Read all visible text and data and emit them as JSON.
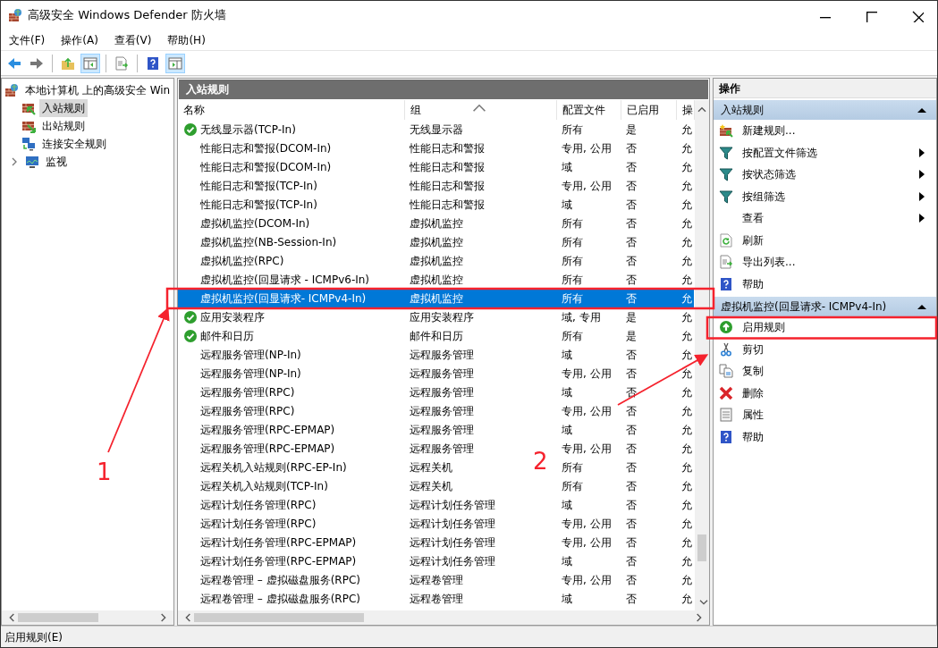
{
  "window": {
    "title": "高级安全 Windows Defender 防火墙"
  },
  "menu": [
    "文件(F)",
    "操作(A)",
    "查看(V)",
    "帮助(H)"
  ],
  "toolbar": [
    {
      "pressed": false
    },
    {
      "pressed": false
    },
    {
      "pressed": false
    },
    {
      "pressed": true
    },
    {
      "pressed": false
    },
    {
      "pressed": false
    },
    {
      "pressed": true
    }
  ],
  "tree": {
    "label": "本地计算机 上的高级安全 Win",
    "children": [
      {
        "label": "入站规则",
        "selected": true
      },
      {
        "label": "出站规则",
        "selected": false
      },
      {
        "label": "连接安全规则",
        "selected": false
      },
      {
        "label": "监视",
        "selected": false,
        "expanded": false
      }
    ]
  },
  "center": {
    "title": "入站规则",
    "columns": [
      "名称",
      "组",
      "配置文件",
      "已启用",
      "操"
    ],
    "rows": [
      {
        "name": "无线显示器(TCP-In)",
        "group": "无线显示器",
        "profile": "所有",
        "enabled": "是",
        "action": "允",
        "active": true,
        "selected": false
      },
      {
        "name": "性能日志和警报(DCOM-In)",
        "group": "性能日志和警报",
        "profile": "专用, 公用",
        "enabled": "否",
        "action": "允",
        "active": false,
        "selected": false
      },
      {
        "name": "性能日志和警报(DCOM-In)",
        "group": "性能日志和警报",
        "profile": "域",
        "enabled": "否",
        "action": "允",
        "active": false,
        "selected": false
      },
      {
        "name": "性能日志和警报(TCP-In)",
        "group": "性能日志和警报",
        "profile": "专用, 公用",
        "enabled": "否",
        "action": "允",
        "active": false,
        "selected": false
      },
      {
        "name": "性能日志和警报(TCP-In)",
        "group": "性能日志和警报",
        "profile": "域",
        "enabled": "否",
        "action": "允",
        "active": false,
        "selected": false
      },
      {
        "name": "虚拟机监控(DCOM-In)",
        "group": "虚拟机监控",
        "profile": "所有",
        "enabled": "否",
        "action": "允",
        "active": false,
        "selected": false
      },
      {
        "name": "虚拟机监控(NB-Session-In)",
        "group": "虚拟机监控",
        "profile": "所有",
        "enabled": "否",
        "action": "允",
        "active": false,
        "selected": false
      },
      {
        "name": "虚拟机监控(RPC)",
        "group": "虚拟机监控",
        "profile": "所有",
        "enabled": "否",
        "action": "允",
        "active": false,
        "selected": false
      },
      {
        "name": "虚拟机监控(回显请求 - ICMPv6-In)",
        "group": "虚拟机监控",
        "profile": "所有",
        "enabled": "否",
        "action": "允",
        "active": false,
        "selected": false
      },
      {
        "name": "虚拟机监控(回显请求- ICMPv4-In)",
        "group": "虚拟机监控",
        "profile": "所有",
        "enabled": "否",
        "action": "允",
        "active": false,
        "selected": true
      },
      {
        "name": "应用安装程序",
        "group": "应用安装程序",
        "profile": "域, 专用",
        "enabled": "是",
        "action": "允",
        "active": true,
        "selected": false
      },
      {
        "name": "邮件和日历",
        "group": "邮件和日历",
        "profile": "所有",
        "enabled": "是",
        "action": "允",
        "active": true,
        "selected": false
      },
      {
        "name": "远程服务管理(NP-In)",
        "group": "远程服务管理",
        "profile": "域",
        "enabled": "否",
        "action": "允",
        "active": false,
        "selected": false
      },
      {
        "name": "远程服务管理(NP-In)",
        "group": "远程服务管理",
        "profile": "专用, 公用",
        "enabled": "否",
        "action": "允",
        "active": false,
        "selected": false
      },
      {
        "name": "远程服务管理(RPC)",
        "group": "远程服务管理",
        "profile": "域",
        "enabled": "否",
        "action": "允",
        "active": false,
        "selected": false
      },
      {
        "name": "远程服务管理(RPC)",
        "group": "远程服务管理",
        "profile": "专用, 公用",
        "enabled": "否",
        "action": "允",
        "active": false,
        "selected": false
      },
      {
        "name": "远程服务管理(RPC-EPMAP)",
        "group": "远程服务管理",
        "profile": "域",
        "enabled": "否",
        "action": "允",
        "active": false,
        "selected": false
      },
      {
        "name": "远程服务管理(RPC-EPMAP)",
        "group": "远程服务管理",
        "profile": "专用, 公用",
        "enabled": "否",
        "action": "允",
        "active": false,
        "selected": false
      },
      {
        "name": "远程关机入站规则(RPC-EP-In)",
        "group": "远程关机",
        "profile": "所有",
        "enabled": "否",
        "action": "允",
        "active": false,
        "selected": false
      },
      {
        "name": "远程关机入站规则(TCP-In)",
        "group": "远程关机",
        "profile": "所有",
        "enabled": "否",
        "action": "允",
        "active": false,
        "selected": false
      },
      {
        "name": "远程计划任务管理(RPC)",
        "group": "远程计划任务管理",
        "profile": "域",
        "enabled": "否",
        "action": "允",
        "active": false,
        "selected": false
      },
      {
        "name": "远程计划任务管理(RPC)",
        "group": "远程计划任务管理",
        "profile": "专用, 公用",
        "enabled": "否",
        "action": "允",
        "active": false,
        "selected": false
      },
      {
        "name": "远程计划任务管理(RPC-EPMAP)",
        "group": "远程计划任务管理",
        "profile": "专用, 公用",
        "enabled": "否",
        "action": "允",
        "active": false,
        "selected": false
      },
      {
        "name": "远程计划任务管理(RPC-EPMAP)",
        "group": "远程计划任务管理",
        "profile": "域",
        "enabled": "否",
        "action": "允",
        "active": false,
        "selected": false
      },
      {
        "name": "远程卷管理 – 虚拟磁盘服务(RPC)",
        "group": "远程卷管理",
        "profile": "专用, 公用",
        "enabled": "否",
        "action": "允",
        "active": false,
        "selected": false
      },
      {
        "name": "远程卷管理 – 虚拟磁盘服务(RPC)",
        "group": "远程卷管理",
        "profile": "域",
        "enabled": "否",
        "action": "允",
        "active": false,
        "selected": false
      }
    ]
  },
  "actions": {
    "title": "操作",
    "sections": [
      {
        "title": "入站规则",
        "items": [
          {
            "label": "新建规则...",
            "submenu": false
          },
          {
            "label": "按配置文件筛选",
            "submenu": true
          },
          {
            "label": "按状态筛选",
            "submenu": true
          },
          {
            "label": "按组筛选",
            "submenu": true
          },
          {
            "label": "查看",
            "submenu": true
          },
          {
            "label": "刷新",
            "submenu": false
          },
          {
            "label": "导出列表...",
            "submenu": false
          },
          {
            "label": "帮助",
            "submenu": false
          }
        ]
      },
      {
        "title": "虚拟机监控(回显请求- ICMPv4-In)",
        "items": [
          {
            "label": "启用规则",
            "submenu": false
          },
          {
            "label": "剪切",
            "submenu": false
          },
          {
            "label": "复制",
            "submenu": false
          },
          {
            "label": "删除",
            "submenu": false
          },
          {
            "label": "属性",
            "submenu": false
          },
          {
            "label": "帮助",
            "submenu": false
          }
        ]
      }
    ]
  },
  "status_bar": "启用规则(E)",
  "annotations": [
    "1",
    "2"
  ]
}
